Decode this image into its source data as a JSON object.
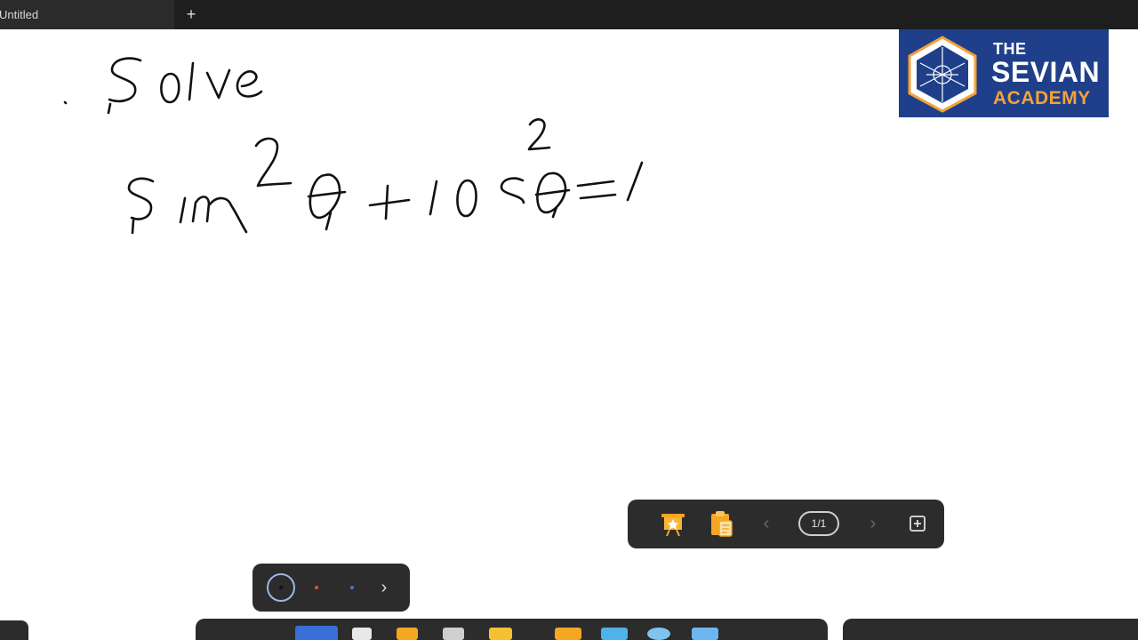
{
  "tabs": [
    {
      "label": "Untitled",
      "active": true
    }
  ],
  "new_tab_symbol": "+",
  "logo": {
    "line1": "THE",
    "line2": "SEVIAN",
    "line3": "ACADEMY",
    "background": "#1f3f8a",
    "accent": "#f2a23a"
  },
  "page_nav": {
    "counter": "1/1",
    "prev_symbol": "‹",
    "next_symbol": "›",
    "icons": [
      "presentation-icon",
      "clipboard-icon",
      "add-page-icon"
    ]
  },
  "pen_tray": {
    "colors": [
      "#111111",
      "#d9534f",
      "#4a73d6"
    ],
    "more_symbol": "›"
  },
  "colors": {
    "toolbar_bg": "#2c2c2c",
    "tabbar_bg": "#1e1e1e",
    "ink": "#111111"
  }
}
